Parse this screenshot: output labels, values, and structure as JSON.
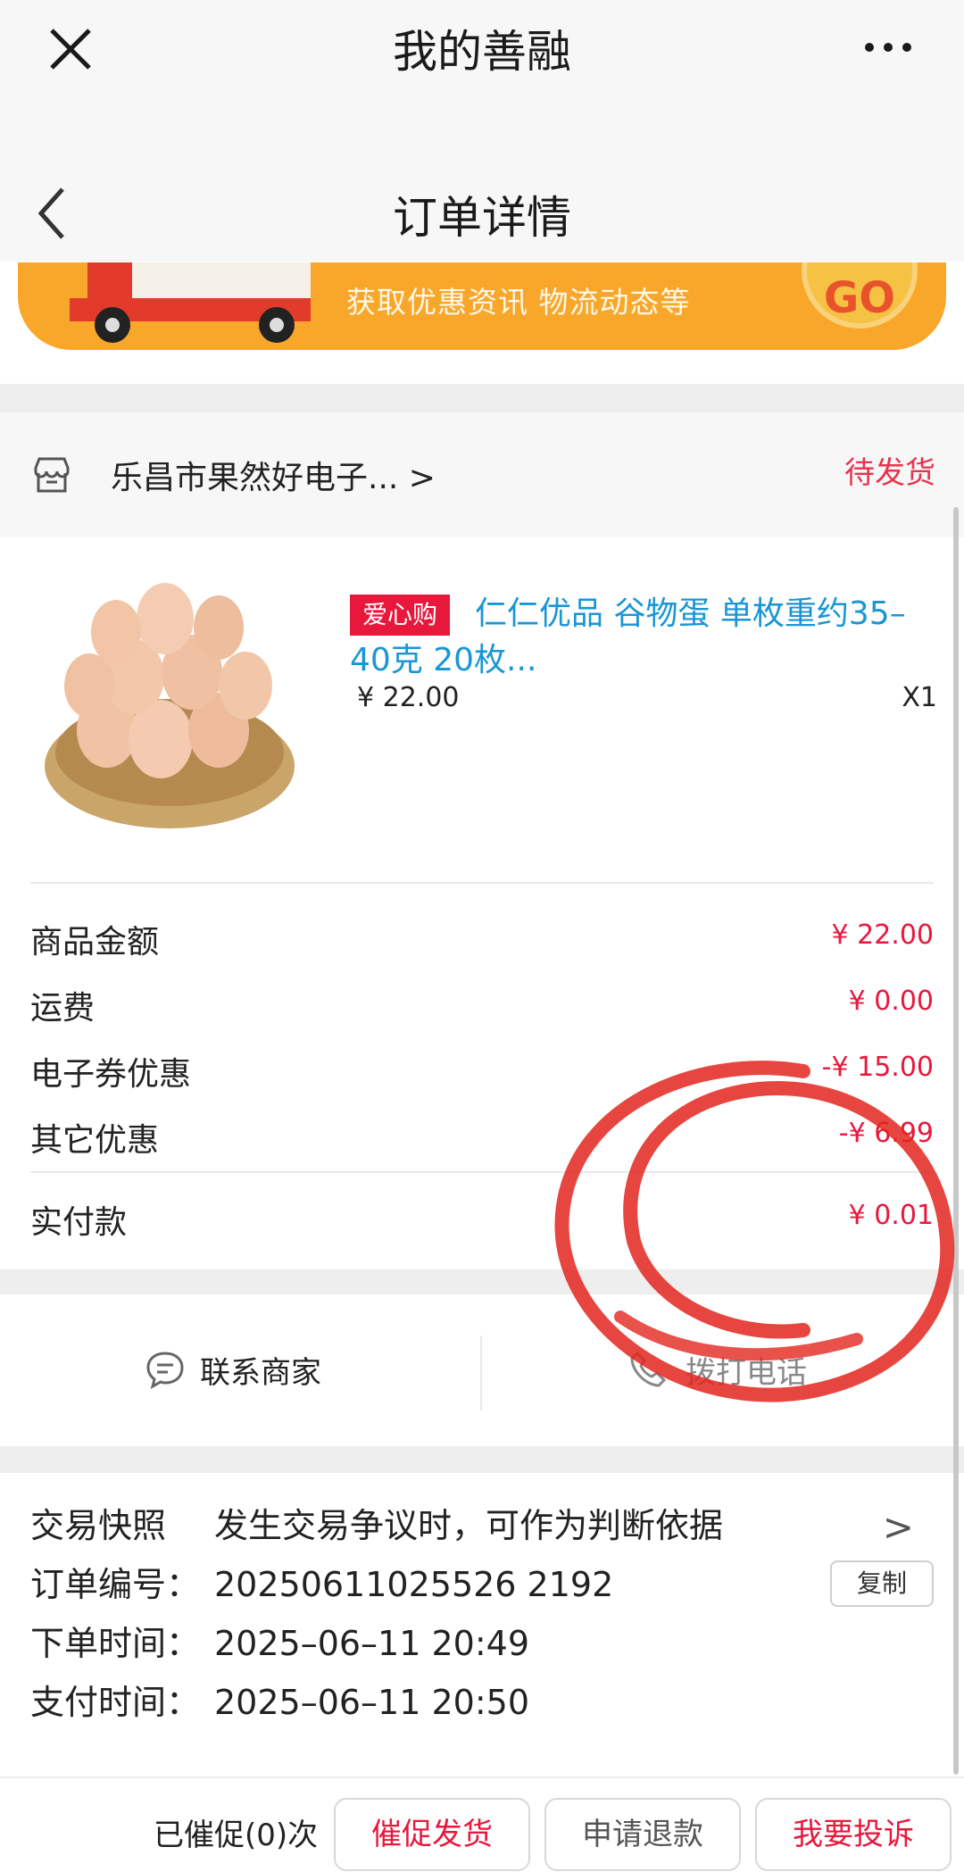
{
  "topbar": {
    "title": "我的善融"
  },
  "navbar": {
    "title": "订单详情"
  },
  "banner": {
    "text": "获取优惠资讯 物流动态等",
    "go_label": "GO"
  },
  "shop": {
    "name": "乐昌市果然好电子... >",
    "status": "待发货"
  },
  "product": {
    "tag": "爱心购",
    "title": "仁仁优品 谷物蛋 单枚重约35–40克 20枚...",
    "price": "¥ 22.00",
    "quantity": "X1"
  },
  "amounts": {
    "goods_label": "商品金额",
    "goods_value": "¥ 22.00",
    "shipping_label": "运费",
    "shipping_value": "¥ 0.00",
    "coupon_label": "电子券优惠",
    "coupon_value": "-¥ 15.00",
    "other_label": "其它优惠",
    "other_value": "-¥ 6.99",
    "paid_label": "实付款",
    "paid_value": "¥ 0.01"
  },
  "contact": {
    "merchant_label": "联系商家",
    "phone_label": "拨打电话"
  },
  "info": {
    "snapshot_label": "交易快照",
    "snapshot_value": "发生交易争议时，可作为判断依据",
    "order_no_label": "订单编号：",
    "order_no_value": "20250611025526 2192",
    "order_time_label": "下单时间：",
    "order_time_value": "2025–06–11 20:49",
    "pay_time_label": "支付时间：",
    "pay_time_value": "2025–06–11 20:50",
    "copy_label": "复制",
    "arrow": ">"
  },
  "bottom": {
    "urge_count": "已催促(0)次",
    "urge_label": "催促发货",
    "refund_label": "申请退款",
    "complain_label": "我要投诉"
  },
  "colors": {
    "accent_red": "#e8183d",
    "link_blue": "#1996d4",
    "banner_orange": "#f9a72a"
  }
}
